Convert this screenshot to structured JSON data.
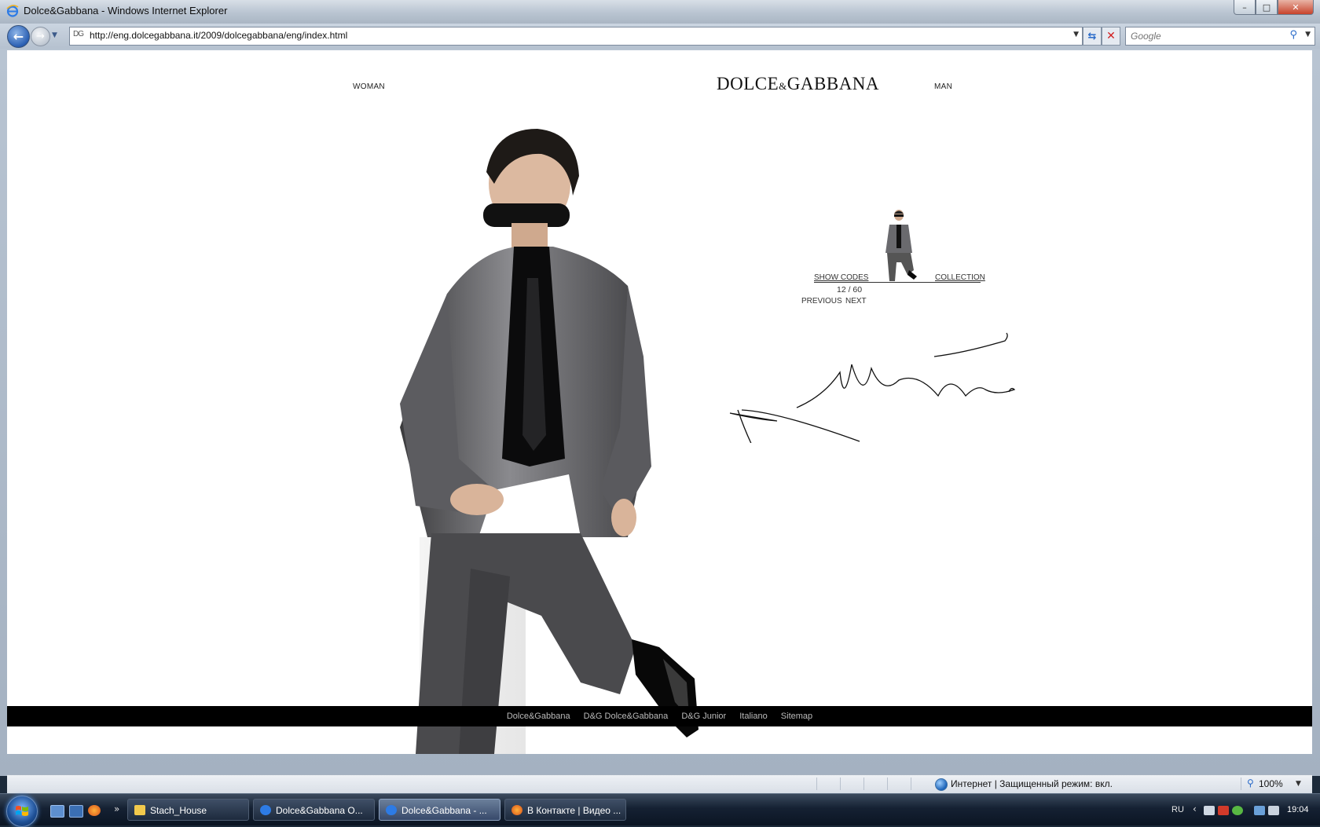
{
  "window": {
    "title": "Dolce&Gabbana - Windows Internet Explorer",
    "controls": {
      "minimize": "–",
      "maximize": "□",
      "close": "✕"
    }
  },
  "toolbar": {
    "url": "http://eng.dolcegabbana.it/2009/dolcegabbana/eng/index.html",
    "favicon_text": "DG",
    "search_placeholder": "Google"
  },
  "site": {
    "nav_left": "WOMAN",
    "logo_main_1": "DOLCE",
    "logo_amp": "&",
    "logo_main_2": "GABBANA",
    "nav_right": "MAN",
    "gallery": {
      "show_codes": "SHOW CODES",
      "collection": "COLLECTION",
      "counter": "12 / 60",
      "previous": "PREVIOUS",
      "next": "NEXT"
    },
    "footer_links": [
      "Dolce&Gabbana",
      "D&G Dolce&Gabbana",
      "D&G Junior",
      "Italiano",
      "Sitemap"
    ]
  },
  "statusbar": {
    "zone": "Интернет | Защищенный режим: вкл.",
    "zoom": "100%"
  },
  "taskbar": {
    "quicklaunch_more": "»",
    "tasks": [
      {
        "label": "Stach_House",
        "icon": "folder-icon"
      },
      {
        "label": "Dolce&Gabbana O...",
        "icon": "ie-icon"
      },
      {
        "label": "Dolce&Gabbana - ...",
        "icon": "ie-icon",
        "active": true
      },
      {
        "label": "В Контакте | Видео ...",
        "icon": "firefox-icon"
      }
    ],
    "lang": "RU",
    "clock": "19:04"
  },
  "colors": {
    "footer_bg": "#000000",
    "page_bg": "#ffffff",
    "taskbar_bg": "#152133"
  }
}
